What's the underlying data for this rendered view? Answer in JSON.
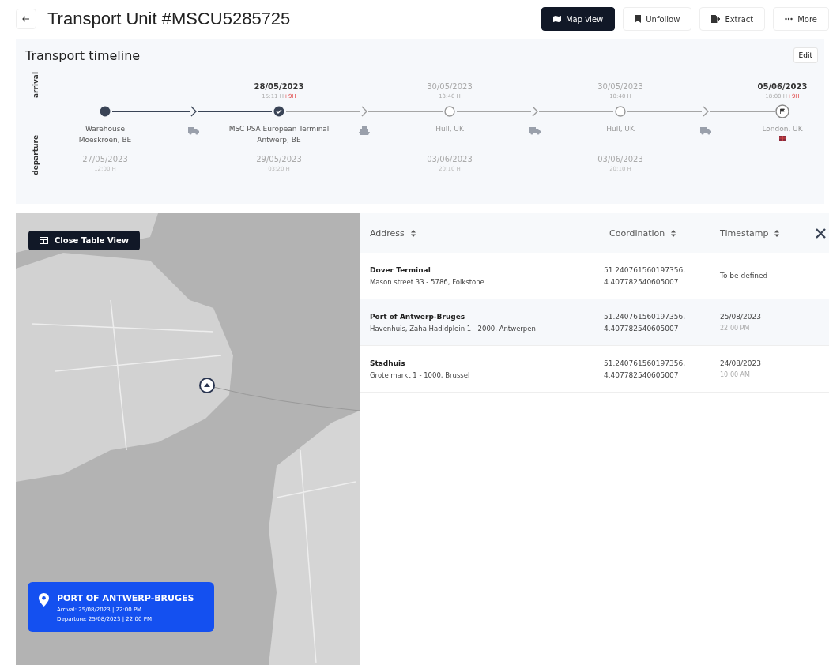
{
  "header": {
    "title": "Transport Unit #MSCU5285725",
    "actions": [
      {
        "label": "Map view",
        "kind": "map",
        "selected": true
      },
      {
        "label": "Unfollow",
        "kind": "bookmark",
        "selected": false
      },
      {
        "label": "Extract",
        "kind": "extract",
        "selected": false
      },
      {
        "label": "More",
        "kind": "more",
        "selected": false
      }
    ]
  },
  "timeline": {
    "title": "Transport timeline",
    "edit_label": "Edit",
    "arrival_label": "arrival",
    "departure_label": "departure",
    "stops": [
      {
        "kind": "done",
        "place": [
          "Warehouse",
          "Moeskroen, BE"
        ],
        "departure_date": "27/05/2023",
        "departure_time": "12:00 H"
      },
      {
        "kind": "current",
        "arrival_date": "28/05/2023",
        "arrival_time": "15:11 H",
        "delay": "+9H",
        "place": [
          "MSC PSA European Terminal",
          "Antwerp, BE"
        ],
        "departure_date": "29/05/2023",
        "departure_time": "03:20 H"
      },
      {
        "kind": "pending",
        "arrival_date": "30/05/2023",
        "arrival_time": "13:40 H",
        "place": [
          "Hull, UK"
        ],
        "departure_date": "03/06/2023",
        "departure_time": "20:10 H"
      },
      {
        "kind": "pending",
        "arrival_date": "30/05/2023",
        "arrival_time": "10:40 H",
        "place": [
          "Hull, UK"
        ],
        "departure_date": "03/06/2023",
        "departure_time": "20:10 H"
      },
      {
        "kind": "destination",
        "arrival_date": "05/06/2023",
        "arrival_time": "18:00 H",
        "delay": "+9H",
        "place": [
          "London, UK"
        ]
      }
    ],
    "legs": [
      {
        "kind": "truck",
        "completed": true
      },
      {
        "kind": "ship",
        "completed": false
      },
      {
        "kind": "truck",
        "completed": false
      },
      {
        "kind": "truck",
        "completed": false
      }
    ]
  },
  "map": {
    "toggle_label": "Close Table View",
    "card": {
      "title": "PORT OF ANTWERP-BRUGES",
      "arrival": "Arrival: 25/08/2023 | 22:00 PM",
      "departure": "Departure: 25/08/2023 | 22:00 PM"
    }
  },
  "table": {
    "columns": [
      {
        "label": "Address"
      },
      {
        "label": "Coordination"
      },
      {
        "label": "Timestamp"
      }
    ],
    "rows": [
      {
        "name": "Dover Terminal",
        "address": "Mason street 33 - 5786, Folkstone",
        "coordination": [
          "51.240761560197356,",
          "4.407782540605007"
        ],
        "date": "To be defined"
      },
      {
        "name": "Port of Antwerp-Bruges",
        "address": "Havenhuis, Zaha Hadidplein 1 - 2000, Antwerpen",
        "coordination": [
          "51.240761560197356,",
          "4.407782540605007"
        ],
        "date": "25/08/2023",
        "time": "22:00 PM"
      },
      {
        "name": "Stadhuis",
        "address": "Grote markt 1 - 1000, Brussel",
        "coordination": [
          "51.240761560197356,",
          "4.407782540605007"
        ],
        "date": "24/08/2023",
        "time": "10:00 AM"
      }
    ]
  }
}
